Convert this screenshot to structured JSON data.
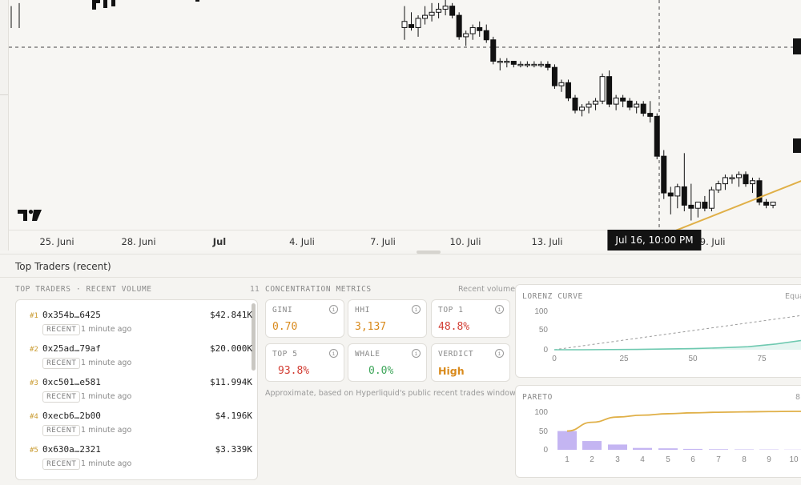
{
  "colors": {
    "up": "#ffffff",
    "down": "#111111",
    "trendline": "#e0b048",
    "lorenz": "#6ec9b0",
    "pareto_bar": "#c4b5f2",
    "pareto_line": "#e0b048",
    "gini": "#d98a1c",
    "hhi": "#d98a1c",
    "top1": "#d23c32",
    "top5": "#d23c32",
    "whale": "#3ea65a",
    "verdict": "#d98a1c",
    "rank": "#c99a2e"
  },
  "price_chart": {
    "x_labels": [
      {
        "text": "25. Juni",
        "bold": false
      },
      {
        "text": "28. Juni",
        "bold": false
      },
      {
        "text": "Jul",
        "bold": true
      },
      {
        "text": "4. Juli",
        "bold": false
      },
      {
        "text": "7. Juli",
        "bold": false
      },
      {
        "text": "10. Juli",
        "bold": false
      },
      {
        "text": "13. Juli",
        "bold": false
      },
      {
        "text": "19. Juli",
        "bold": false
      }
    ],
    "crosshair_label": "Jul 16, 10:00 PM",
    "logo_icon": "tradingview-logo-icon"
  },
  "section_header": "Top Traders (recent)",
  "top_traders": {
    "title": "TOP TRADERS · RECENT VOLUME",
    "count": "11",
    "rows": [
      {
        "rank": "#1",
        "address": "0x354b…6425",
        "volume": "$42.841K",
        "tag": "RECENT",
        "time": "1 minute ago"
      },
      {
        "rank": "#2",
        "address": "0x25ad…79af",
        "volume": "$20.000K",
        "tag": "RECENT",
        "time": "1 minute ago"
      },
      {
        "rank": "#3",
        "address": "0xc501…e581",
        "volume": "$11.994K",
        "tag": "RECENT",
        "time": "1 minute ago"
      },
      {
        "rank": "#4",
        "address": "0xecb6…2b00",
        "volume": "$4.196K",
        "tag": "RECENT",
        "time": "1 minute ago"
      },
      {
        "rank": "#5",
        "address": "0x630a…2321",
        "volume": "$3.339K",
        "tag": "RECENT",
        "time": "1 minute ago"
      }
    ]
  },
  "concentration": {
    "title": "CONCENTRATION METRICS",
    "subtitle": "Recent volume",
    "metrics": [
      {
        "label": "GINI",
        "value": "0.70"
      },
      {
        "label": "HHI",
        "value": "3,137"
      },
      {
        "label": "TOP 1",
        "value": "48.8%"
      },
      {
        "label": "TOP 5",
        "value": "93.8%"
      },
      {
        "label": "WHALE",
        "value": "0.0%"
      },
      {
        "label": "VERDICT",
        "value": "High"
      }
    ],
    "info_icon_text": "i",
    "note": "Approximate, based on Hyperliquid's public recent trades window."
  },
  "lorenz": {
    "title": "LORENZ CURVE",
    "legend": "Equa",
    "y_ticks": [
      "100",
      "50",
      "0"
    ],
    "x_ticks": [
      "0",
      "25",
      "50",
      "75"
    ]
  },
  "pareto": {
    "title": "PARETO",
    "legend": "8",
    "y_ticks": [
      "100",
      "50",
      "0"
    ],
    "x_ticks": [
      "1",
      "2",
      "3",
      "4",
      "5",
      "6",
      "7",
      "8",
      "9",
      "10"
    ]
  },
  "chart_data": [
    {
      "type": "candlestick",
      "candles": [
        [
          96,
          103,
          92,
          98
        ],
        [
          97,
          101,
          95,
          96
        ],
        [
          96,
          100,
          93,
          99
        ],
        [
          99,
          103,
          97,
          100
        ],
        [
          100,
          104,
          98,
          101
        ],
        [
          101,
          104,
          99,
          102
        ],
        [
          102,
          105,
          100,
          103
        ],
        [
          103,
          104,
          99,
          100
        ],
        [
          100,
          101,
          92,
          93
        ],
        [
          93,
          95,
          90,
          94
        ],
        [
          94,
          97,
          92,
          96
        ],
        [
          96,
          98,
          93,
          95
        ],
        [
          95,
          97,
          91,
          92
        ],
        [
          92,
          93,
          84,
          85
        ],
        [
          85,
          86,
          82,
          85
        ],
        [
          85,
          86,
          83,
          85
        ],
        [
          85,
          85,
          83,
          84
        ],
        [
          84,
          85,
          83,
          84
        ],
        [
          84,
          85,
          83,
          84
        ],
        [
          84,
          85,
          83,
          84
        ],
        [
          84,
          85,
          83,
          84
        ],
        [
          84,
          85,
          82,
          83
        ],
        [
          83,
          84,
          76,
          77
        ],
        [
          77,
          79,
          75,
          78
        ],
        [
          78,
          79,
          72,
          73
        ],
        [
          73,
          74,
          68,
          69
        ],
        [
          69,
          71,
          67,
          70
        ],
        [
          70,
          72,
          68,
          71
        ],
        [
          71,
          73,
          69,
          72
        ],
        [
          72,
          81,
          71,
          80
        ],
        [
          80,
          82,
          70,
          71
        ],
        [
          71,
          74,
          69,
          73
        ],
        [
          73,
          74,
          70,
          72
        ],
        [
          72,
          73,
          69,
          70
        ],
        [
          70,
          72,
          68,
          71
        ],
        [
          71,
          72,
          67,
          68
        ],
        [
          68,
          72,
          65,
          67
        ],
        [
          67,
          68,
          53,
          54
        ],
        [
          54,
          56,
          40,
          42
        ],
        [
          42,
          44,
          35,
          41
        ],
        [
          41,
          45,
          37,
          44
        ],
        [
          44,
          55,
          36,
          38
        ],
        [
          38,
          45,
          33,
          37
        ],
        [
          37,
          39,
          34,
          39
        ],
        [
          39,
          41,
          36,
          37
        ],
        [
          37,
          44,
          36,
          43
        ],
        [
          43,
          46,
          42,
          45
        ],
        [
          45,
          48,
          43,
          47
        ],
        [
          47,
          48,
          45,
          47
        ],
        [
          47,
          49,
          44,
          48
        ],
        [
          48,
          49,
          44,
          45
        ],
        [
          45,
          47,
          42,
          46
        ],
        [
          46,
          47,
          38,
          39
        ],
        [
          39,
          40,
          37,
          38
        ],
        [
          38,
          39,
          37,
          39
        ]
      ],
      "trendline": [
        [
          38,
          28
        ],
        [
          54,
          46
        ]
      ]
    },
    {
      "type": "area",
      "title": "LORENZ CURVE",
      "x": [
        0,
        10,
        20,
        30,
        40,
        50,
        60,
        70,
        80,
        90,
        100
      ],
      "series": [
        {
          "values": [
            0,
            0,
            0.5,
            1,
            2,
            3,
            5,
            8,
            15,
            25,
            100
          ]
        },
        {
          "values": [
            0,
            10,
            20,
            30,
            40,
            50,
            60,
            70,
            80,
            90,
            100
          ]
        }
      ],
      "xlim": [
        0,
        100
      ],
      "ylim": [
        0,
        100
      ]
    },
    {
      "type": "bar",
      "title": "PARETO",
      "categories": [
        "1",
        "2",
        "3",
        "4",
        "5",
        "6",
        "7",
        "8",
        "9",
        "10"
      ],
      "series": [
        {
          "values": [
            48.8,
            22.8,
            13.7,
            4.8,
            3.8,
            2.3,
            1.5,
            1.0,
            0.8,
            0.5
          ]
        },
        {
          "values": [
            48.8,
            71.6,
            85.3,
            90.1,
            93.9,
            96.2,
            97.7,
            98.7,
            99.5,
            100
          ]
        }
      ],
      "ylim": [
        0,
        100
      ]
    }
  ]
}
